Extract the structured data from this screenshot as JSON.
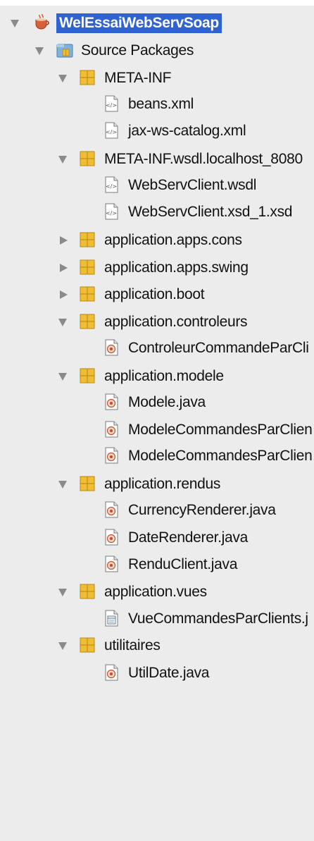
{
  "tree": {
    "project": {
      "label": "WelEssaiWebServSoap"
    },
    "source_packages": {
      "label": "Source Packages"
    },
    "packages": {
      "meta_inf": {
        "label": "META-INF",
        "files": [
          "beans.xml",
          "jax-ws-catalog.xml"
        ]
      },
      "meta_inf_wsdl": {
        "label": "META-INF.wsdl.localhost_8080",
        "files": [
          "WebServClient.wsdl",
          "WebServClient.xsd_1.xsd"
        ]
      },
      "apps_cons": {
        "label": "application.apps.cons"
      },
      "apps_swing": {
        "label": "application.apps.swing"
      },
      "boot": {
        "label": "application.boot"
      },
      "controleurs": {
        "label": "application.controleurs",
        "files": [
          "ControleurCommandeParCli"
        ]
      },
      "modele": {
        "label": "application.modele",
        "files": [
          "Modele.java",
          "ModeleCommandesParClien",
          "ModeleCommandesParClien"
        ]
      },
      "rendus": {
        "label": "application.rendus",
        "files": [
          "CurrencyRenderer.java",
          "DateRenderer.java",
          "RenduClient.java"
        ]
      },
      "vues": {
        "label": "application.vues",
        "files": [
          "VueCommandesParClients.j"
        ]
      },
      "utilitaires": {
        "label": "utilitaires",
        "files": [
          "UtilDate.java"
        ]
      }
    }
  },
  "colors": {
    "selection": "#2f63d1",
    "package_icon": "#e9b52a",
    "arrow": "#8a8a8a"
  }
}
